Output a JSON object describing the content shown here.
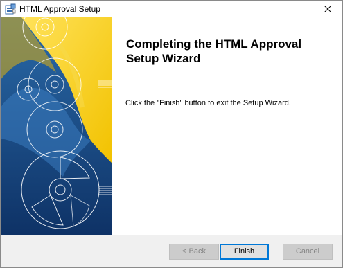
{
  "window": {
    "title": "HTML Approval Setup"
  },
  "icons": {
    "app": "setup-installer-icon",
    "close": "close-icon",
    "banner": "cd-disc-artwork"
  },
  "content": {
    "heading": "Completing the HTML Approval Setup Wizard",
    "message": "Click the \"Finish\" button to exit the Setup Wizard."
  },
  "buttons": {
    "back": "< Back",
    "finish": "Finish",
    "cancel": "Cancel"
  },
  "colors": {
    "banner_blue": "#1b4f8e",
    "banner_yellow": "#f6cc14",
    "accent": "#0078d7",
    "footer_bg": "#f0f0f0"
  }
}
